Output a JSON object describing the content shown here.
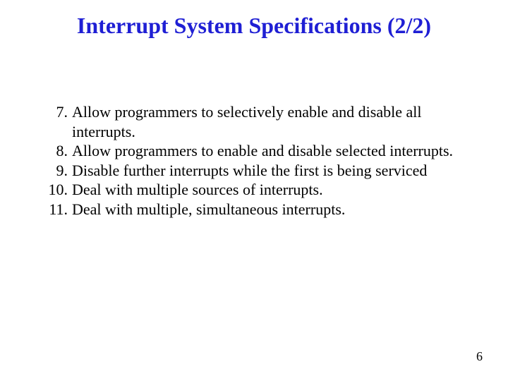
{
  "slide": {
    "title": "Interrupt System Specifications (2/2)",
    "page_number": "6",
    "items": [
      {
        "n": "7.",
        "text": "Allow programmers to selectively enable and disable all interrupts."
      },
      {
        "n": "8.",
        "text": "Allow programmers to enable and disable selected interrupts."
      },
      {
        "n": "9.",
        "text": "Disable further interrupts while the first is being serviced"
      },
      {
        "n": "10.",
        "text": "Deal with multiple sources of interrupts."
      },
      {
        "n": "11.",
        "text": "Deal with multiple, simultaneous interrupts."
      }
    ]
  }
}
